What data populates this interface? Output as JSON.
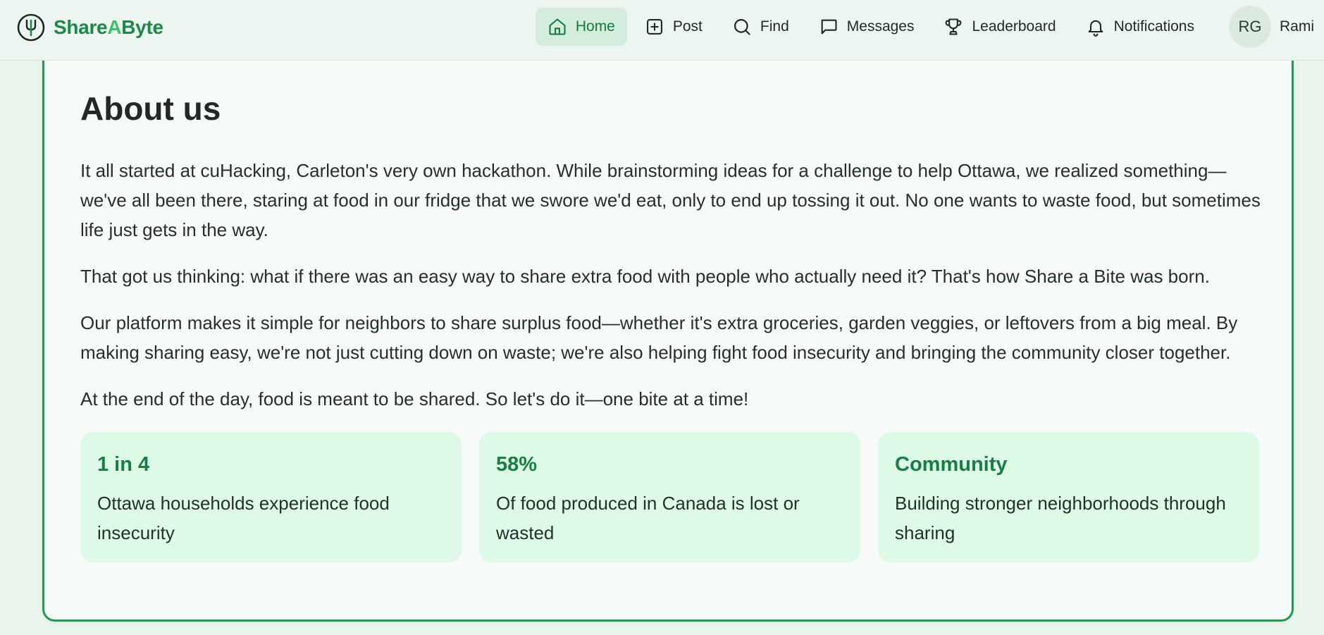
{
  "brand": {
    "part1": "Share",
    "part2": "A",
    "part3": "Byte"
  },
  "nav": {
    "items": [
      {
        "label": "Home",
        "icon": "home-icon"
      },
      {
        "label": "Post",
        "icon": "plus-square-icon"
      },
      {
        "label": "Find",
        "icon": "search-icon"
      },
      {
        "label": "Messages",
        "icon": "message-icon"
      },
      {
        "label": "Leaderboard",
        "icon": "trophy-icon"
      },
      {
        "label": "Notifications",
        "icon": "bell-icon"
      }
    ],
    "active": "Home"
  },
  "user": {
    "initials": "RG",
    "name": "Rami"
  },
  "about": {
    "title": "About us",
    "paragraphs": [
      "It all started at cuHacking, Carleton's very own hackathon. While brainstorming ideas for a challenge to help Ottawa, we realized something—we've all been there, staring at food in our fridge that we swore we'd eat, only to end up tossing it out. No one wants to waste food, but sometimes life just gets in the way.",
      "That got us thinking: what if there was an easy way to share extra food with people who actually need it? That's how Share a Bite was born.",
      "Our platform makes it simple for neighbors to share surplus food—whether it's extra groceries, garden veggies, or leftovers from a big meal. By making sharing easy, we're not just cutting down on waste; we're also helping fight food insecurity and bringing the community closer together.",
      "At the end of the day, food is meant to be shared. So let's do it—one bite at a time!"
    ]
  },
  "stats": [
    {
      "title": "1 in 4",
      "desc": "Ottawa households experience food insecurity"
    },
    {
      "title": "58%",
      "desc": "Of food produced in Canada is lost or wasted"
    },
    {
      "title": "Community",
      "desc": "Building stronger neighborhoods through sharing"
    }
  ],
  "colors": {
    "accent": "#1e9a52",
    "brand": "#1a8a47",
    "stat_bg": "#dcfae6",
    "active_nav_bg": "#d3ecdb"
  }
}
